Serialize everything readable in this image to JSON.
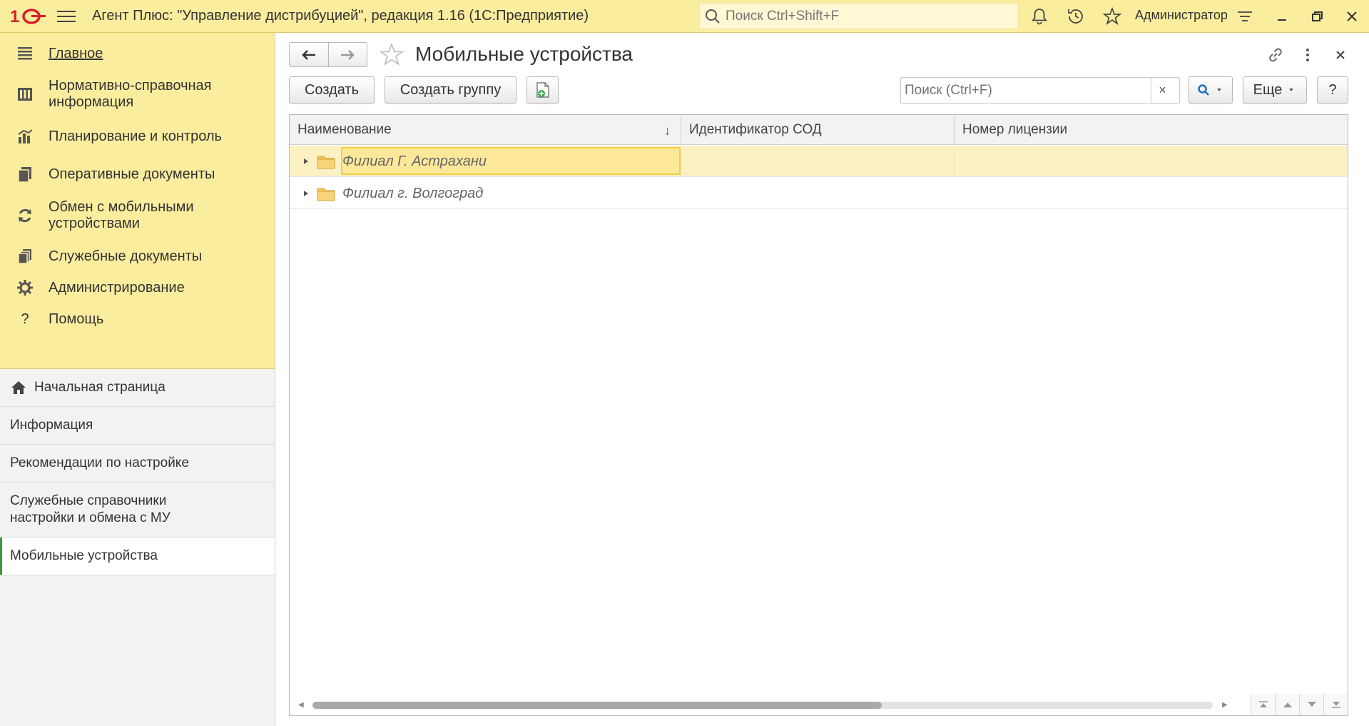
{
  "titlebar": {
    "app_title": "Агент Плюс: \"Управление дистрибуцией\", редакция 1.16  (1С:Предприятие)",
    "search_placeholder": "Поиск Ctrl+Shift+F",
    "user": "Администратор",
    "icons": [
      "bell-icon",
      "history-icon",
      "star-icon",
      "settings-lines-icon",
      "minimize-icon",
      "restore-icon",
      "close-icon"
    ]
  },
  "sidebar": {
    "sections": [
      {
        "label": "Главное",
        "icon": "menu-list-icon",
        "active": true
      },
      {
        "label": "Нормативно-справочная информация",
        "icon": "catalog-icon"
      },
      {
        "label": "Планирование и контроль",
        "icon": "chart-icon"
      },
      {
        "label": "Оперативные документы",
        "icon": "documents-icon"
      },
      {
        "label": "Обмен с мобильными устройствами",
        "icon": "sync-icon"
      },
      {
        "label": "Служебные документы",
        "icon": "service-docs-icon"
      },
      {
        "label": "Администрирование",
        "icon": "gear-icon"
      },
      {
        "label": "Помощь",
        "icon": "help-icon"
      }
    ],
    "nav": [
      {
        "label": "Начальная страница",
        "icon": "home-icon"
      },
      {
        "label": "Информация"
      },
      {
        "label": "Рекомендации по настройке"
      },
      {
        "label": "Служебные справочники настройки и обмена с МУ"
      },
      {
        "label": "Мобильные устройства",
        "current": true
      }
    ]
  },
  "form": {
    "title": "Мобильные устройства",
    "buttons": {
      "create": "Создать",
      "create_group": "Создать группу",
      "more": "Еще",
      "help": "?"
    },
    "search_placeholder": "Поиск (Ctrl+F)",
    "clear_symbol": "×"
  },
  "table": {
    "columns": [
      "Наименование",
      "Идентификатор СОД",
      "Номер лицензии"
    ],
    "sort_indicator": "↓",
    "rows": [
      {
        "name": "Филиал Г. Астрахани",
        "sod_id": "",
        "license": "",
        "type": "group",
        "selected": true
      },
      {
        "name": "Филиал г. Волгоград",
        "sod_id": "",
        "license": "",
        "type": "group",
        "selected": false
      }
    ]
  },
  "colors": {
    "titlebar_bg": "#fbed9e",
    "selected_row": "#fbf1c3",
    "focus_border": "#f4cd43",
    "current_nav_marker": "#3c9a3c",
    "logo_red": "#d7202b"
  }
}
